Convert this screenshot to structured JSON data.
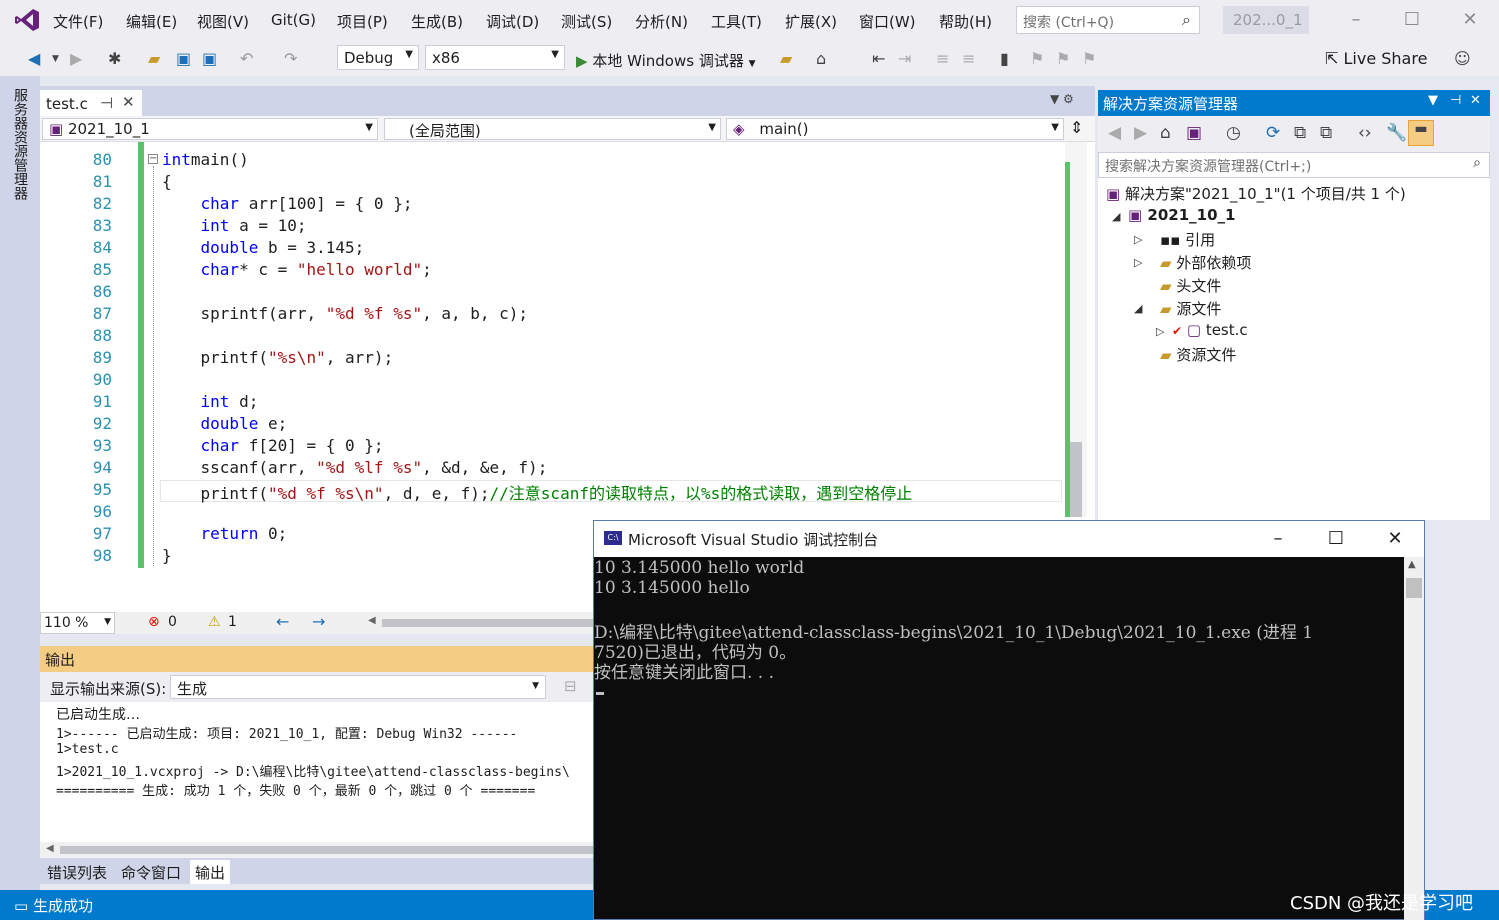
{
  "menu": [
    "文件(F)",
    "编辑(E)",
    "视图(V)",
    "Git(G)",
    "项目(P)",
    "生成(B)",
    "调试(D)",
    "测试(S)",
    "分析(N)",
    "工具(T)",
    "扩展(X)",
    "窗口(W)",
    "帮助(H)"
  ],
  "search_placeholder": "搜索 (Ctrl+Q)",
  "project_badge": "202...0_1",
  "toolbar": {
    "config": "Debug",
    "platform": "x86",
    "run_label": "本地 Windows 调试器",
    "live_share": "Live Share"
  },
  "left_strip_label": "服务器资源管理器",
  "editor": {
    "tab_name": "test.c",
    "nav_project": "2021_10_1",
    "nav_scope": "(全局范围)",
    "nav_function": "main()",
    "zoom": "110 %",
    "errors": "0",
    "warnings": "1",
    "lines": [
      {
        "n": "80",
        "t": [
          [
            "kw",
            "int"
          ],
          [
            "",
            "main()"
          ]
        ]
      },
      {
        "n": "81",
        "t": [
          [
            "",
            "{"
          ]
        ]
      },
      {
        "n": "82",
        "t": [
          [
            "",
            "    "
          ],
          [
            "kw",
            "char"
          ],
          [
            "",
            " arr[100] = { 0 };"
          ]
        ]
      },
      {
        "n": "83",
        "t": [
          [
            "",
            "    "
          ],
          [
            "kw",
            "int"
          ],
          [
            "",
            " a = 10;"
          ]
        ]
      },
      {
        "n": "84",
        "t": [
          [
            "",
            "    "
          ],
          [
            "kw",
            "double"
          ],
          [
            "",
            " b = 3.145;"
          ]
        ]
      },
      {
        "n": "85",
        "t": [
          [
            "",
            "    "
          ],
          [
            "kw",
            "char"
          ],
          [
            "",
            "* c = "
          ],
          [
            "str",
            "\"hello world\""
          ],
          [
            "",
            ";"
          ]
        ]
      },
      {
        "n": "86",
        "t": []
      },
      {
        "n": "87",
        "t": [
          [
            "",
            "    sprintf(arr, "
          ],
          [
            "str",
            "\"%d %f %s\""
          ],
          [
            "",
            ", a, b, c);"
          ]
        ]
      },
      {
        "n": "88",
        "t": []
      },
      {
        "n": "89",
        "t": [
          [
            "",
            "    printf("
          ],
          [
            "str",
            "\"%s\\n\""
          ],
          [
            "",
            ", arr);"
          ]
        ]
      },
      {
        "n": "90",
        "t": []
      },
      {
        "n": "91",
        "t": [
          [
            "",
            "    "
          ],
          [
            "kw",
            "int"
          ],
          [
            "",
            " d;"
          ]
        ]
      },
      {
        "n": "92",
        "t": [
          [
            "",
            "    "
          ],
          [
            "kw",
            "double"
          ],
          [
            "",
            " e;"
          ]
        ]
      },
      {
        "n": "93",
        "t": [
          [
            "",
            "    "
          ],
          [
            "kw",
            "char"
          ],
          [
            "",
            " f[20] = { 0 };"
          ]
        ]
      },
      {
        "n": "94",
        "t": [
          [
            "",
            "    sscanf(arr, "
          ],
          [
            "str",
            "\"%d %lf %s\""
          ],
          [
            "",
            ", &d, &e, f);"
          ]
        ]
      },
      {
        "n": "95",
        "t": [
          [
            "",
            "    printf("
          ],
          [
            "str",
            "\"%d %f %s\\n\""
          ],
          [
            "",
            ", d, e, f);"
          ],
          [
            "cm",
            "//注意scanf的读取特点，以%s的格式读取，遇到空格停止"
          ]
        ]
      },
      {
        "n": "96",
        "t": []
      },
      {
        "n": "97",
        "t": [
          [
            "",
            "    "
          ],
          [
            "kw",
            "return"
          ],
          [
            "",
            " 0;"
          ]
        ]
      },
      {
        "n": "98",
        "t": [
          [
            "",
            "}"
          ]
        ]
      }
    ]
  },
  "output": {
    "title": "输出",
    "source_label": "显示输出来源(S):",
    "source_value": "生成",
    "lines": [
      "已启动生成…",
      "1>------ 已启动生成: 项目: 2021_10_1, 配置: Debug Win32 ------",
      "1>test.c",
      "1>2021_10_1.vcxproj -> D:\\编程\\比特\\gitee\\attend-classclass-begins\\",
      "========== 生成: 成功 1 个，失败 0 个，最新 0 个，跳过 0 个 ======="
    ]
  },
  "bottom_tabs": [
    "错误列表",
    "命令窗口",
    "输出"
  ],
  "status": "生成成功",
  "solution_explorer": {
    "title": "解决方案资源管理器",
    "search_placeholder": "搜索解决方案资源管理器(Ctrl+;)",
    "solution": "解决方案\"2021_10_1\"(1 个项目/共 1 个)",
    "project": "2021_10_1",
    "items": [
      "引用",
      "外部依赖项",
      "头文件",
      "源文件",
      "test.c",
      "资源文件"
    ]
  },
  "console": {
    "title": "Microsoft Visual Studio 调试控制台",
    "lines": [
      "10 3.145000 hello world",
      "10 3.145000 hello",
      "",
      "D:\\编程\\比特\\gitee\\attend-classclass-begins\\2021_10_1\\Debug\\2021_10_1.exe (进程 1",
      "7520)已退出，代码为 0。",
      "按任意键关闭此窗口. . ."
    ]
  },
  "watermark": "CSDN @我还是学习吧"
}
